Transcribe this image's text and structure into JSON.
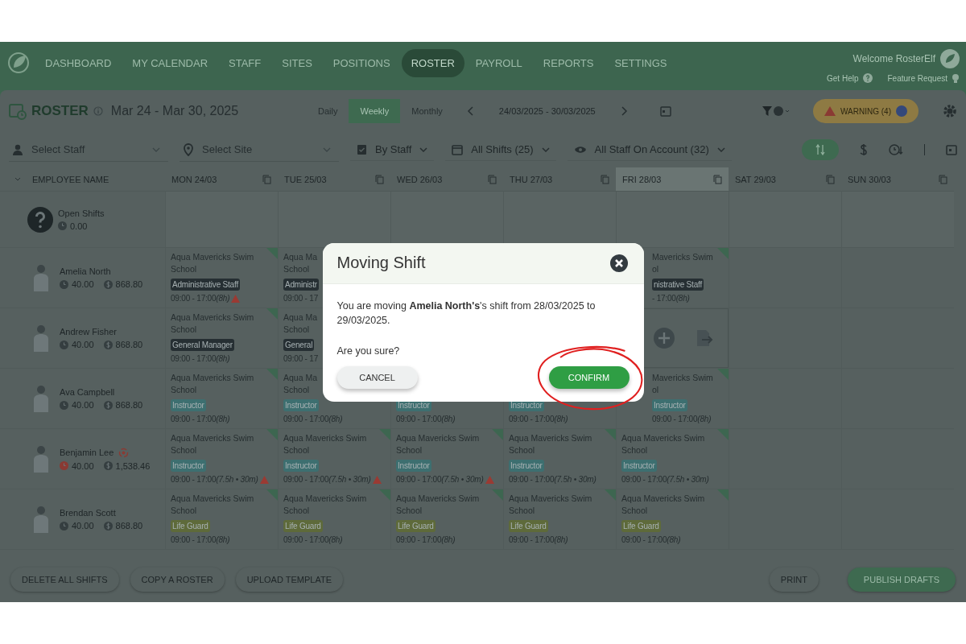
{
  "nav": {
    "items": [
      {
        "label": "DASHBOARD",
        "selected": false
      },
      {
        "label": "MY CALENDAR",
        "selected": false
      },
      {
        "label": "STAFF",
        "selected": false
      },
      {
        "label": "SITES",
        "selected": false
      },
      {
        "label": "POSITIONS",
        "selected": false
      },
      {
        "label": "ROSTER",
        "selected": true
      },
      {
        "label": "PAYROLL",
        "selected": false
      },
      {
        "label": "REPORTS",
        "selected": false
      },
      {
        "label": "SETTINGS",
        "selected": false
      }
    ],
    "welcome": "Welcome RosterElf",
    "help": "Get Help",
    "feature": "Feature Request"
  },
  "toolbar": {
    "title": "ROSTER",
    "range": "Mar 24 - Mar 30, 2025",
    "views": [
      {
        "label": "Daily",
        "selected": false
      },
      {
        "label": "Weekly",
        "selected": true
      },
      {
        "label": "Monthly",
        "selected": false
      }
    ],
    "dates": "24/03/2025 - 30/03/2025",
    "warning": "WARNING (4)"
  },
  "filters": {
    "staff_placeholder": "Select Staff",
    "site_placeholder": "Select Site",
    "dropdowns": [
      "By Staff",
      "All Shifts (25)",
      "All Staff On Account (32)"
    ]
  },
  "grid": {
    "name_header": "EMPLOYEE NAME",
    "days": [
      {
        "label": "MON 24/03",
        "highlighted": false
      },
      {
        "label": "TUE 25/03",
        "highlighted": false
      },
      {
        "label": "WED 26/03",
        "highlighted": false
      },
      {
        "label": "THU 27/03",
        "highlighted": false
      },
      {
        "label": "FRI 28/03",
        "highlighted": true
      },
      {
        "label": "SAT 29/03",
        "highlighted": false
      },
      {
        "label": "SUN 30/03",
        "highlighted": false
      }
    ],
    "open_shifts": {
      "label": "Open Shifts",
      "hours": "0.00"
    },
    "employees": [
      {
        "name": "Amelia North",
        "hours": "40.00",
        "cost": "868.80",
        "hours_alert": false,
        "swap": false,
        "shifts": [
          {
            "kind": "shift",
            "site_lines": [
              "Aqua Mavericks Swim",
              "School"
            ],
            "position": "Administrative Staff",
            "color": "#262f33",
            "time": "09:00 - 17:00",
            "duration": "(8h)",
            "warning": true
          },
          {
            "kind": "shift_partial",
            "site_lines": [
              "Aqua Ma",
              "School"
            ],
            "position": "Administr",
            "color": "#262f33",
            "time": "09:00 - 17",
            "warning": false
          },
          {
            "kind": "covered"
          },
          {
            "kind": "covered"
          },
          {
            "kind": "shift_cut",
            "site_lines": [
              "Mavericks Swim",
              "ol"
            ],
            "position": "nistrative Staff",
            "color": "#262f33",
            "time": "- 17:00",
            "duration": "(8h)",
            "warning": false
          },
          {
            "kind": "empty"
          },
          {
            "kind": "empty"
          }
        ]
      },
      {
        "name": "Andrew Fisher",
        "hours": "40.00",
        "cost": "868.80",
        "hours_alert": false,
        "swap": false,
        "shifts": [
          {
            "kind": "shift",
            "site_lines": [
              "Aqua Mavericks Swim",
              "School"
            ],
            "position": "General Manager",
            "color": "#262f33",
            "time": "09:00 - 17:00",
            "duration": "(8h)",
            "warning": false
          },
          {
            "kind": "shift_partial",
            "site_lines": [
              "Aqua Ma",
              "School"
            ],
            "position": "General",
            "color": "#262f33",
            "time": "09:00 - 17",
            "warning": false
          },
          {
            "kind": "covered"
          },
          {
            "kind": "covered"
          },
          {
            "kind": "actions"
          },
          {
            "kind": "empty"
          },
          {
            "kind": "empty"
          }
        ]
      },
      {
        "name": "Ava Campbell",
        "hours": "40.00",
        "cost": "868.80",
        "hours_alert": false,
        "swap": false,
        "shifts": [
          {
            "kind": "shift",
            "site_lines": [
              "Aqua Mavericks Swim",
              "School"
            ],
            "position": "Instructor",
            "color": "#3d6f70",
            "time": "09:00 - 17:00",
            "duration": "(8h)",
            "warning": false
          },
          {
            "kind": "shift",
            "site_lines": [
              "Aqua Ma",
              "School"
            ],
            "position": "Instructor",
            "color": "#3d6f70",
            "time": "09:00 - 17:00",
            "duration": "(8h)",
            "warning": false
          },
          {
            "kind": "shift",
            "position": "Instructor",
            "color": "#3d6f70",
            "time": "09:00 - 17:00",
            "duration": "(8h)",
            "warning": false
          },
          {
            "kind": "shift",
            "position": "Instructor",
            "color": "#3d6f70",
            "time": "09:00 - 17:00",
            "duration": "(8h)",
            "warning": false
          },
          {
            "kind": "shift_cut",
            "site_lines": [
              "Mavericks Swim",
              "ol"
            ],
            "position": "Instructor",
            "color": "#3d6f70",
            "time": "09:00 - 17:00",
            "duration": "(8h)",
            "warning": false
          },
          {
            "kind": "empty"
          },
          {
            "kind": "empty"
          }
        ]
      },
      {
        "name": "Benjamin Lee",
        "hours": "40.00",
        "cost": "1,538.46",
        "hours_alert": true,
        "swap": true,
        "shifts": [
          {
            "kind": "shift",
            "site_lines": [
              "Aqua Mavericks Swim",
              "School"
            ],
            "position": "Instructor",
            "color": "#3d6f70",
            "time": "09:00 - 17:00",
            "duration": "(7.5h • 30m)",
            "warning": true
          },
          {
            "kind": "shift",
            "site_lines": [
              "Aqua Mavericks Swim",
              "School"
            ],
            "position": "Instructor",
            "color": "#3d6f70",
            "time": "09:00 - 17:00",
            "duration": "(7.5h • 30m)",
            "warning": true
          },
          {
            "kind": "shift",
            "site_lines": [
              "Aqua Mavericks Swim",
              "School"
            ],
            "position": "Instructor",
            "color": "#3d6f70",
            "time": "09:00 - 17:00",
            "duration": "(7.5h • 30m)",
            "warning": true
          },
          {
            "kind": "shift",
            "site_lines": [
              "Aqua Mavericks Swim",
              "School"
            ],
            "position": "Instructor",
            "color": "#3d6f70",
            "time": "09:00 - 17:00",
            "duration": "(7.5h • 30m)",
            "warning": false
          },
          {
            "kind": "shift",
            "site_lines": [
              "Aqua Mavericks Swim",
              "School"
            ],
            "position": "Instructor",
            "color": "#3d6f70",
            "time": "09:00 - 17:00",
            "duration": "(7.5h • 30m)",
            "warning": false
          },
          {
            "kind": "empty"
          },
          {
            "kind": "empty"
          }
        ]
      },
      {
        "name": "Brendan Scott",
        "hours": "40.00",
        "cost": "868.80",
        "hours_alert": false,
        "swap": false,
        "shifts": [
          {
            "kind": "shift",
            "site_lines": [
              "Aqua Mavericks Swim",
              "School"
            ],
            "position": "Life Guard",
            "color": "#5e6a3a",
            "time": "09:00 - 17:00",
            "duration": "(8h)",
            "warning": false
          },
          {
            "kind": "shift",
            "site_lines": [
              "Aqua Mavericks Swim",
              "School"
            ],
            "position": "Life Guard",
            "color": "#5e6a3a",
            "time": "09:00 - 17:00",
            "duration": "(8h)",
            "warning": false
          },
          {
            "kind": "shift",
            "site_lines": [
              "Aqua Mavericks Swim",
              "School"
            ],
            "position": "Life Guard",
            "color": "#5e6a3a",
            "time": "09:00 - 17:00",
            "duration": "(8h)",
            "warning": false
          },
          {
            "kind": "shift",
            "site_lines": [
              "Aqua Mavericks Swim",
              "School"
            ],
            "position": "Life Guard",
            "color": "#5e6a3a",
            "time": "09:00 - 17:00",
            "duration": "(8h)",
            "warning": false
          },
          {
            "kind": "shift",
            "site_lines": [
              "Aqua Mavericks Swim",
              "School"
            ],
            "position": "Life Guard",
            "color": "#5e6a3a",
            "time": "09:00 - 17:00",
            "duration": "(8h)",
            "warning": false
          },
          {
            "kind": "empty"
          },
          {
            "kind": "empty"
          }
        ]
      }
    ]
  },
  "footer": {
    "left": [
      "DELETE ALL SHIFTS",
      "COPY A ROSTER",
      "UPLOAD TEMPLATE"
    ],
    "print": "PRINT",
    "publish": "PUBLISH DRAFTS"
  },
  "dialog": {
    "title": "Moving Shift",
    "message": "You are moving **Amelia North's**'s shift from 28/03/2025 to 29/03/2025.",
    "question": "Are you sure?",
    "cancel": "CANCEL",
    "confirm": "CONFIRM"
  }
}
